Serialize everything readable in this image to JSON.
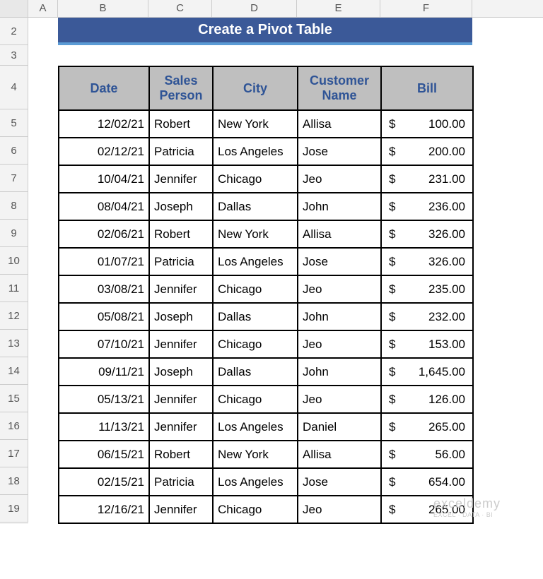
{
  "columns": [
    "A",
    "B",
    "C",
    "D",
    "E",
    "F"
  ],
  "row_numbers": [
    2,
    3,
    4,
    5,
    6,
    7,
    8,
    9,
    10,
    11,
    12,
    13,
    14,
    15,
    16,
    17,
    18,
    19
  ],
  "title": "Create a Pivot Table",
  "headers": {
    "date": "Date",
    "sales_person": "Sales Person",
    "city": "City",
    "customer": "Customer Name",
    "bill": "Bill"
  },
  "currency_symbol": "$",
  "rows": [
    {
      "date": "12/02/21",
      "person": "Robert",
      "city": "New York",
      "customer": "Allisa",
      "bill": "100.00"
    },
    {
      "date": "02/12/21",
      "person": "Patricia",
      "city": "Los Angeles",
      "customer": "Jose",
      "bill": "200.00"
    },
    {
      "date": "10/04/21",
      "person": "Jennifer",
      "city": "Chicago",
      "customer": "Jeo",
      "bill": "231.00"
    },
    {
      "date": "08/04/21",
      "person": "Joseph",
      "city": "Dallas",
      "customer": "John",
      "bill": "236.00"
    },
    {
      "date": "02/06/21",
      "person": "Robert",
      "city": "New York",
      "customer": "Allisa",
      "bill": "326.00"
    },
    {
      "date": "01/07/21",
      "person": "Patricia",
      "city": "Los Angeles",
      "customer": "Jose",
      "bill": "326.00"
    },
    {
      "date": "03/08/21",
      "person": "Jennifer",
      "city": "Chicago",
      "customer": "Jeo",
      "bill": "235.00"
    },
    {
      "date": "05/08/21",
      "person": "Joseph",
      "city": "Dallas",
      "customer": "John",
      "bill": "232.00"
    },
    {
      "date": "07/10/21",
      "person": "Jennifer",
      "city": "Chicago",
      "customer": "Jeo",
      "bill": "153.00"
    },
    {
      "date": "09/11/21",
      "person": "Joseph",
      "city": "Dallas",
      "customer": "John",
      "bill": "1,645.00"
    },
    {
      "date": "05/13/21",
      "person": "Jennifer",
      "city": "Chicago",
      "customer": "Jeo",
      "bill": "126.00"
    },
    {
      "date": "11/13/21",
      "person": "Jennifer",
      "city": "Los Angeles",
      "customer": "Daniel",
      "bill": "265.00"
    },
    {
      "date": "06/15/21",
      "person": "Robert",
      "city": "New York",
      "customer": "Allisa",
      "bill": "56.00"
    },
    {
      "date": "02/15/21",
      "person": "Patricia",
      "city": "Los Angeles",
      "customer": "Jose",
      "bill": "654.00"
    },
    {
      "date": "12/16/21",
      "person": "Jennifer",
      "city": "Chicago",
      "customer": "Jeo",
      "bill": "265.00"
    }
  ],
  "watermark": {
    "line1": "exceldemy",
    "line2": "EXCEL · DATA · BI"
  }
}
